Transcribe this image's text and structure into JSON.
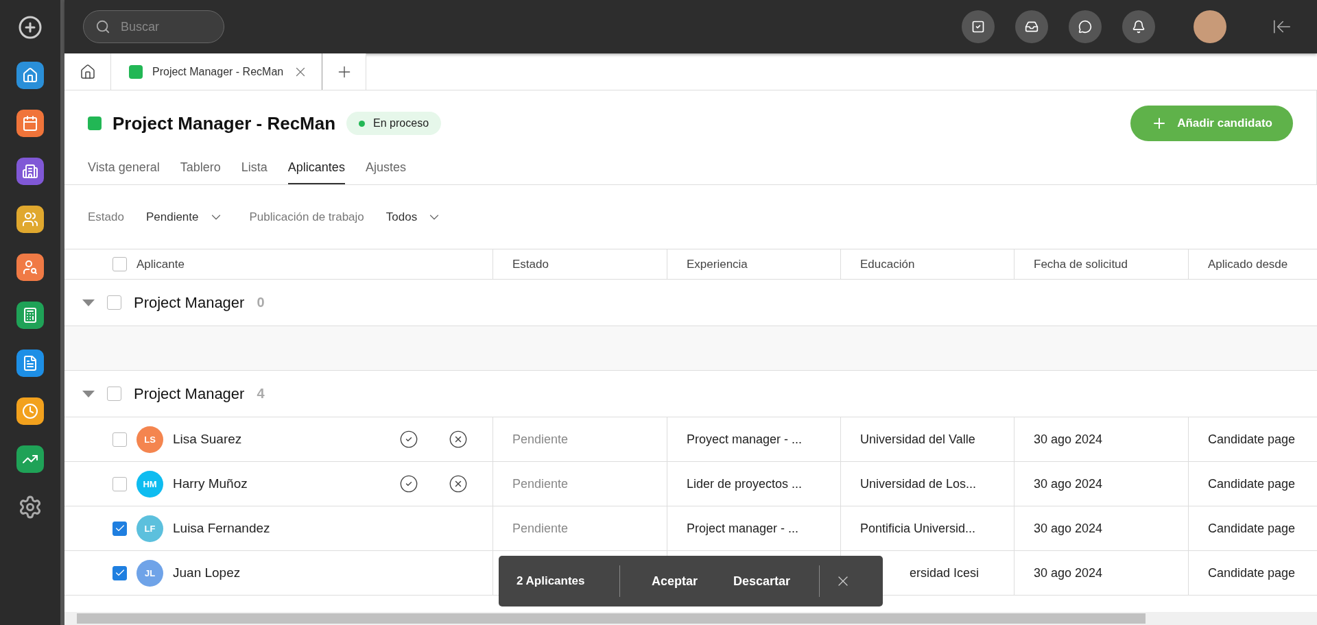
{
  "top_bar": {
    "search": {
      "placeholder": "Buscar"
    }
  },
  "tabs": [
    {
      "label": "Project Manager - RecMan",
      "selected": true
    }
  ],
  "project": {
    "title": "Project Manager - RecMan",
    "status": "En proceso",
    "add_button": "Añadir candidato"
  },
  "nav_tabs": [
    {
      "label": "Vista general",
      "selected": false
    },
    {
      "label": "Tablero",
      "selected": false
    },
    {
      "label": "Lista",
      "selected": false
    },
    {
      "label": "Aplicantes",
      "selected": true
    },
    {
      "label": "Ajustes",
      "selected": false
    }
  ],
  "filters": [
    {
      "label": "Estado",
      "value": "Pendiente"
    },
    {
      "label": "Publicación de trabajo",
      "value": "Todos"
    }
  ],
  "table": {
    "columns": [
      "Aplicante",
      "Estado",
      "Experiencia",
      "Educación",
      "Fecha de solicitud",
      "Aplicado desde"
    ],
    "select_all_checked": false,
    "groups": [
      {
        "title": "Project Manager",
        "count": "0",
        "expanded": true,
        "checked": false
      },
      {
        "title": "Project Manager",
        "count": "4",
        "expanded": true,
        "checked": false,
        "rows": [
          {
            "initials": "LS",
            "name": "Lisa Suarez",
            "color": "#f4854f",
            "checked": false,
            "cells": [
              "Pendiente",
              "Proyect manager - ...",
              "Universidad del Valle",
              "30 ago 2024",
              "Candidate page"
            ]
          },
          {
            "initials": "HM",
            "name": "Harry Muñoz",
            "color": "#0ebcf0",
            "checked": false,
            "cells": [
              "Pendiente",
              "Lider de proyectos ...",
              "Universidad de Los...",
              "30 ago 2024",
              "Candidate page"
            ]
          },
          {
            "initials": "LF",
            "name": "Luisa Fernandez",
            "color": "#5cc0dd",
            "checked": true,
            "cells": [
              "Pendiente",
              "Project manager - ...",
              "Pontificia Universid...",
              "30 ago 2024",
              "Candidate page"
            ]
          },
          {
            "initials": "JL",
            "name": "Juan Lopez",
            "color": "#6fa3e8",
            "checked": true,
            "cells": [
              null,
              null,
              "ersidad Icesi",
              "30 ago 2024",
              "Candidate page"
            ]
          }
        ]
      }
    ]
  },
  "bulk_bar": {
    "count": "2 Aplicantes",
    "actions": [
      "Aceptar",
      "Descartar"
    ]
  }
}
